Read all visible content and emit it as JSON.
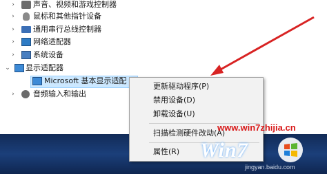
{
  "tree": [
    {
      "label": "声音、视频和游戏控制器",
      "icon": "speaker-icon",
      "expanded": false
    },
    {
      "label": "鼠标和其他指针设备",
      "icon": "mouse-icon",
      "expanded": false
    },
    {
      "label": "通用串行总线控制器",
      "icon": "usb-icon",
      "expanded": false
    },
    {
      "label": "网络适配器",
      "icon": "network-adapter-icon",
      "expanded": false
    },
    {
      "label": "系统设备",
      "icon": "system-device-icon",
      "expanded": false
    },
    {
      "label": "显示适配器",
      "icon": "display-adapter-icon",
      "expanded": true
    },
    {
      "label": "Microsoft 基本显示适配",
      "icon": "monitor-icon",
      "selected": true
    },
    {
      "label": "音频输入和输出",
      "icon": "audio-io-icon",
      "expanded": false
    }
  ],
  "context_menu": {
    "update_driver": "更新驱动程序(P)",
    "disable_device": "禁用设备(D)",
    "uninstall_device": "卸载设备(U)",
    "scan_hardware": "扫描检测硬件改动(A)",
    "properties": "属性(R)"
  },
  "watermark": {
    "url": "www.win7zhijia.cn",
    "logo_text": "Win7",
    "source": "jingyan.baidu.com"
  },
  "colors": {
    "selection": "#cce8ff",
    "arrow": "#d82323",
    "taskbar": "#1b3f7a"
  }
}
